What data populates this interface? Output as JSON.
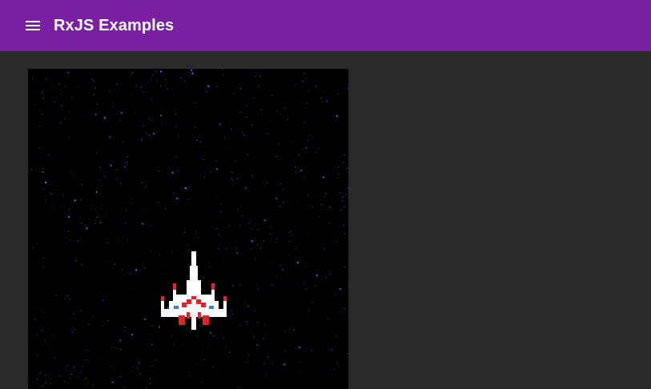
{
  "toolbar": {
    "title": "RxJS Examples",
    "menu_icon": "menu-icon",
    "background": "#7b1fa2"
  },
  "page": {
    "background": "#2b2b2b"
  },
  "game": {
    "background": "#000000",
    "star_color": "#6d6dff",
    "ship_colors": {
      "body": "#ffffff",
      "accent": "#e5212b",
      "window": "#3a7fd5"
    }
  }
}
